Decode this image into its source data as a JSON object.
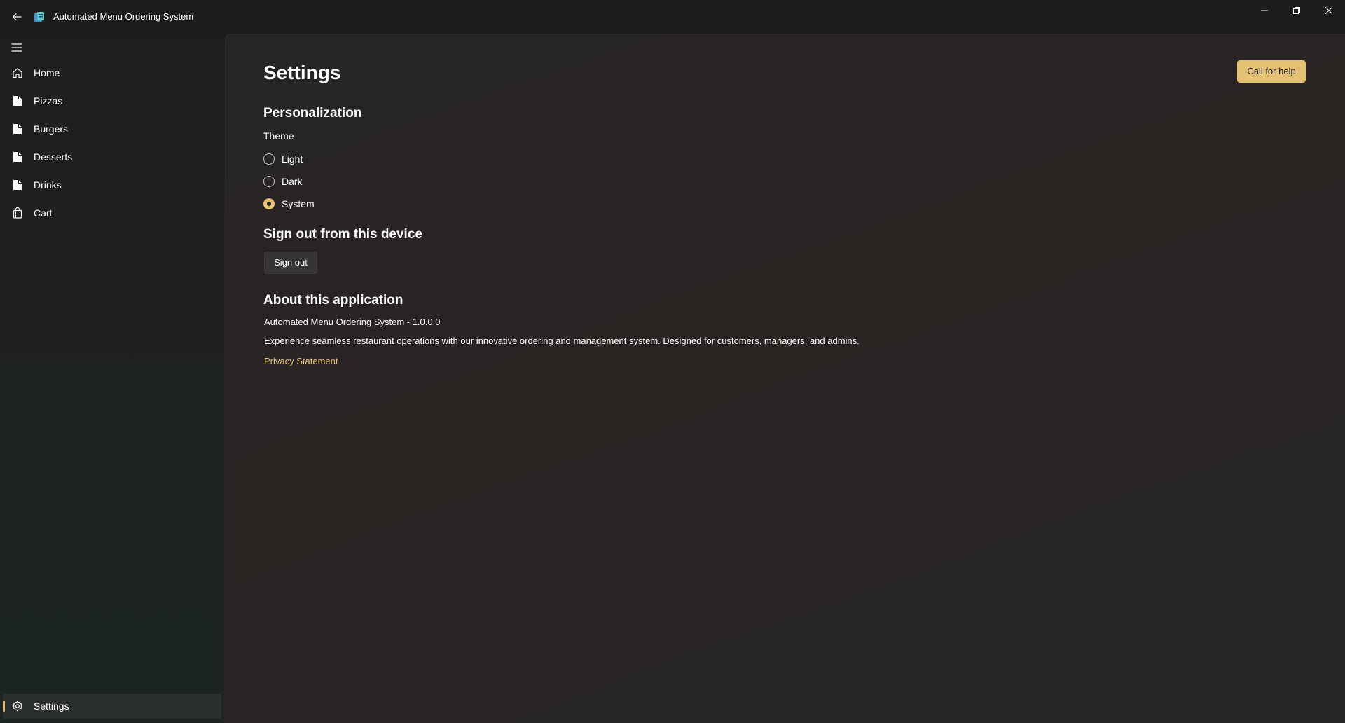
{
  "titlebar": {
    "app_title": "Automated Menu Ordering System",
    "back_icon": "back-arrow-icon",
    "app_icon": "app-logo-icon"
  },
  "sidebar": {
    "hamburger_icon": "hamburger-menu-icon",
    "items": [
      {
        "label": "Home",
        "icon": "home-icon"
      },
      {
        "label": "Pizzas",
        "icon": "document-icon"
      },
      {
        "label": "Burgers",
        "icon": "document-icon"
      },
      {
        "label": "Desserts",
        "icon": "document-icon"
      },
      {
        "label": "Drinks",
        "icon": "document-icon"
      },
      {
        "label": "Cart",
        "icon": "shopping-bag-icon"
      }
    ],
    "settings": {
      "label": "Settings",
      "icon": "gear-icon",
      "selected": true
    }
  },
  "main": {
    "title": "Settings",
    "help_button": "Call for help",
    "personalization": {
      "heading": "Personalization",
      "theme_label": "Theme",
      "options": [
        {
          "label": "Light",
          "checked": false
        },
        {
          "label": "Dark",
          "checked": false
        },
        {
          "label": "System",
          "checked": true
        }
      ]
    },
    "signout": {
      "heading": "Sign out from this device",
      "button": "Sign out"
    },
    "about": {
      "heading": "About this application",
      "version_line": "Automated Menu Ordering System - 1.0.0.0",
      "description": "Experience seamless restaurant operations with our innovative ordering and management system. Designed for customers, managers, and admins.",
      "privacy_link": "Privacy Statement"
    }
  },
  "colors": {
    "accent": "#e4c173",
    "background": "#1f2222",
    "card": "#282525"
  }
}
